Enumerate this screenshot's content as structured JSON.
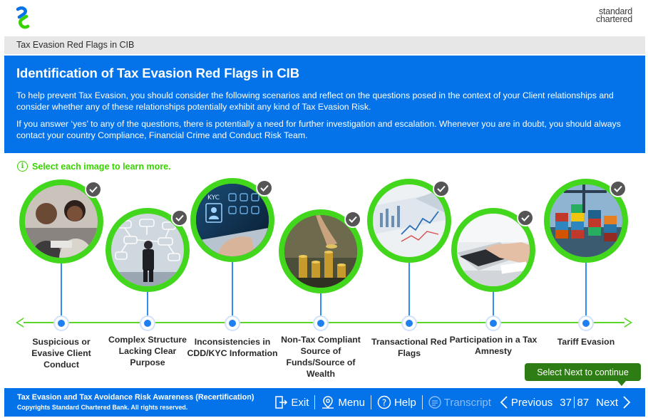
{
  "brand": {
    "line1": "standard",
    "line2": "chartered"
  },
  "breadcrumb": "Tax Evasion Red Flags in CIB",
  "hero": {
    "title": "Identification of Tax Evasion Red Flags in CIB",
    "para1": "To help prevent Tax Evasion, you should consider the following scenarios and reflect on the questions posed in the context of your Client relationships and consider whether any of these relationships potentially exhibit any kind of Tax Evasion Risk.",
    "para2": "If you answer ‘yes’ to any of the questions, there is potentially a need for further investigation and escalation. Whenever you are in doubt, you should always contact your country Compliance, Financial Crime and Conduct Risk Team."
  },
  "instruction": "Select each image to learn more.",
  "items": [
    {
      "label": "Suspicious or Evasive Client Conduct",
      "completed": true,
      "icon": "people-meeting-photo"
    },
    {
      "label": "Complex Structure Lacking Clear Purpose",
      "completed": true,
      "icon": "network-diagram-photo"
    },
    {
      "label": "Inconsistencies in CDD/KYC Information",
      "completed": true,
      "icon": "kyc-laptop-photo",
      "photo_text": "KYC"
    },
    {
      "label": "Non-Tax Compliant Source of Funds/Source of Wealth",
      "completed": true,
      "icon": "coin-stacks-photo"
    },
    {
      "label": "Transactional Red Flags",
      "completed": true,
      "icon": "financial-charts-photo"
    },
    {
      "label": "Participation in a Tax Amnesty",
      "completed": true,
      "icon": "hand-laptop-photo"
    },
    {
      "label": "Tariff Evasion",
      "completed": true,
      "icon": "shipping-containers-photo"
    }
  ],
  "next_tip": "Select Next to continue",
  "footer": {
    "course": "Tax Evasion and Tax Avoidance Risk Awareness (Recertification)",
    "copyright": "Copyrights Standard Chartered Bank. All rights reserved.",
    "exit": "Exit",
    "menu": "Menu",
    "help": "Help",
    "transcript": "Transcript",
    "previous": "Previous",
    "page_current": "37",
    "page_total": "87",
    "next": "Next"
  },
  "colors": {
    "primary_blue": "#0473ea",
    "green": "#42d61c",
    "dark_green": "#2e7d14"
  }
}
